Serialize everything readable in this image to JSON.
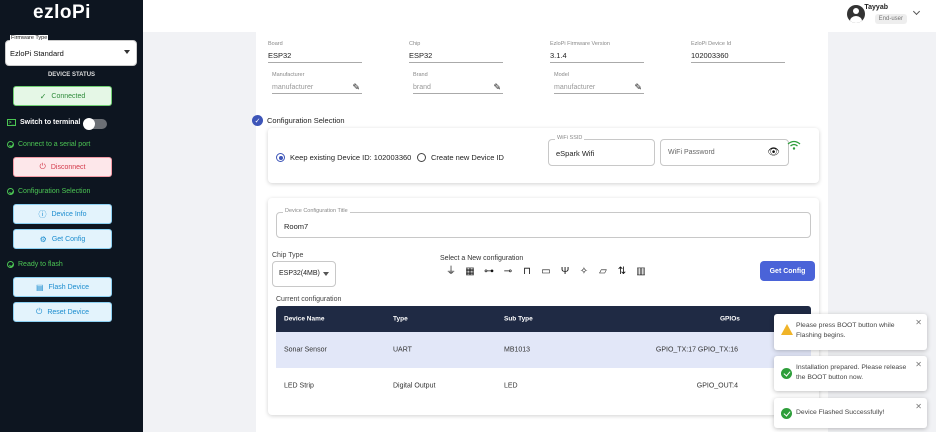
{
  "sidebar": {
    "logo": "ezloPi",
    "firmware_label": "Firmware Type",
    "firmware_value": "EzloPi Standard",
    "device_status_heading": "DEVICE STATUS",
    "connected_label": "Connected",
    "terminal_label": "Switch to terminal",
    "serial_label": "Connect to a serial port",
    "disconnect_label": "Disconnect",
    "config_section": "Configuration Selection",
    "device_info_label": "Device Info",
    "get_config_label": "Get Config",
    "ready_label": "Ready to flash",
    "flash_label": "Flash Device",
    "reset_label": "Reset Device"
  },
  "header": {
    "username": "Tayyab",
    "role": "End-user"
  },
  "info": {
    "board_label": "Board",
    "board_value": "ESP32",
    "chip_label": "Chip",
    "chip_value": "ESP32",
    "fw_version_label": "EzloPi Firmware Version",
    "fw_version_value": "3.1.4",
    "device_id_label": "EzloPi Device Id",
    "device_id_value": "102003360",
    "manufacturer_label": "Manufacturer",
    "manufacturer_placeholder": "manufacturer",
    "brand_label": "Brand",
    "brand_placeholder": "brand",
    "model_label": "Model",
    "model_placeholder": "manufacturer"
  },
  "config_selection": {
    "title": "Configuration Selection",
    "keep_existing": "Keep existing Device ID: 102003360",
    "create_new": "Create new Device ID",
    "wifi_ssid_label": "WiFi SSID",
    "wifi_ssid_value": "eSpark Wifi",
    "wifi_password_placeholder": "WiFi Password"
  },
  "device_config": {
    "title_label": "Device Configuration Title",
    "title_value": "Room7",
    "chip_type_label": "Chip Type",
    "chip_type_value": "ESP32(4MB)",
    "new_config_label": "Select a New configuration",
    "get_config_button": "Get Config",
    "current_config_label": "Current configuration",
    "columns": [
      "Device Name",
      "Type",
      "Sub Type",
      "GPIOs"
    ],
    "rows": [
      {
        "name": "Sonar Sensor",
        "type": "UART",
        "subtype": "MB1013",
        "gpios": "GPIO_TX:17 GPIO_TX:16"
      },
      {
        "name": "LED Strip",
        "type": "Digital Output",
        "subtype": "LED",
        "gpios": "GPIO_OUT:4"
      }
    ],
    "icons": [
      "sensor-icon",
      "relay-icon",
      "servo-icon",
      "potentiometer-icon",
      "switch-icon",
      "ir-icon",
      "antenna-icon",
      "motion-icon",
      "display-icon",
      "swap-icon",
      "keypad-icon"
    ]
  },
  "toasts": [
    {
      "kind": "warning",
      "text": "Please press BOOT button while Flashing begins."
    },
    {
      "kind": "success",
      "text": "Installation prepared. Please release the BOOT button now."
    },
    {
      "kind": "success",
      "text": "Device Flashed Successfully!"
    }
  ],
  "colors": {
    "sidebar": "#0d1520",
    "accent": "#4a63d8",
    "success": "#2e9e3a",
    "danger": "#d33a4b",
    "table_header": "#1f2a44"
  }
}
